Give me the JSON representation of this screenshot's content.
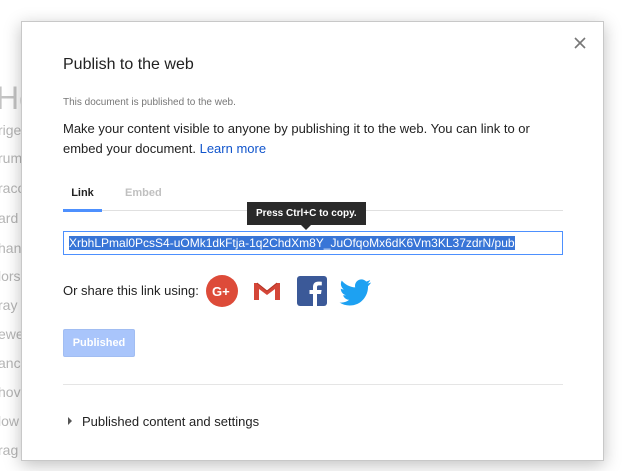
{
  "background": {
    "heading_fragment": "Ho",
    "lines": [
      "rige",
      "rum",
      "raco",
      "ard",
      "han",
      "lors",
      "ray",
      "ewe",
      "anc",
      "hov",
      "low",
      "rag"
    ]
  },
  "dialog": {
    "title": "Publish to the web",
    "status": "This document is published to the web.",
    "description": "Make your content visible to anyone by publishing it to the web. You can link to or embed your document.",
    "learn_more": "Learn more",
    "tabs": [
      {
        "label": "Link",
        "active": true
      },
      {
        "label": "Embed",
        "active": false
      }
    ],
    "tooltip": "Press Ctrl+C to copy.",
    "link_value": "XrbhLPmal0PcsS4-uOMk1dkFtja-1q2ChdXm8Y_JuOfqoMx6dK6Vm3KL37zdrN/pub",
    "share_label": "Or share this link using:",
    "share_services": [
      {
        "icon": "google-plus-icon",
        "color": "#dd4b39"
      },
      {
        "icon": "gmail-icon",
        "color": "#d44638"
      },
      {
        "icon": "facebook-icon",
        "color": "#3b5998"
      },
      {
        "icon": "twitter-icon",
        "color": "#1da1f2"
      }
    ],
    "published_button": "Published",
    "settings_expander": "Published content and settings"
  },
  "colors": {
    "accent": "#4d90fe",
    "link": "#1155cc",
    "selection": "#3875d7",
    "disabled_button": "#a9c5fb"
  }
}
